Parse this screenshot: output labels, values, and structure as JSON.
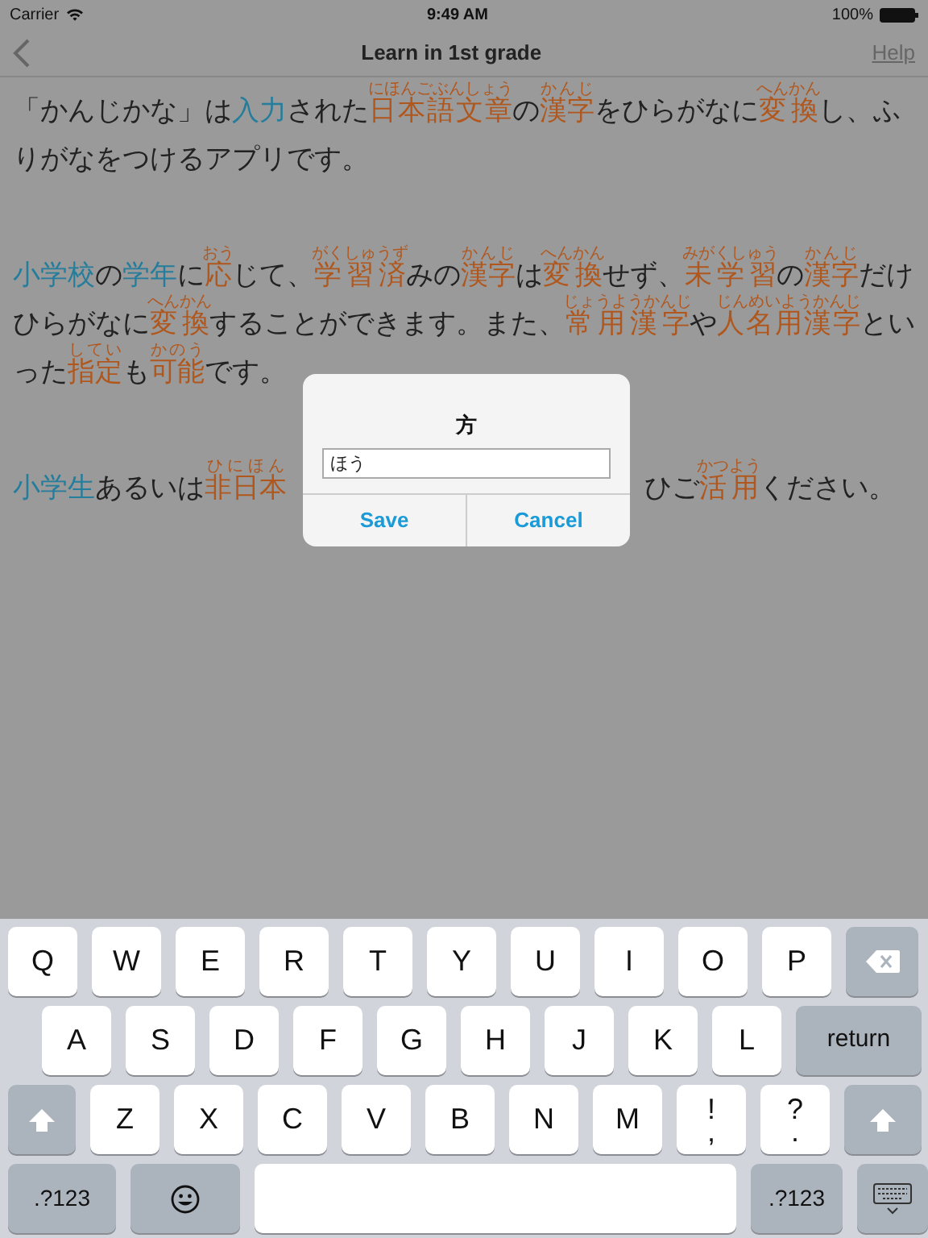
{
  "status_bar": {
    "carrier": "Carrier",
    "time": "9:49 AM",
    "battery": "100%"
  },
  "nav_bar": {
    "title": "Learn in 1st grade",
    "right_button": "Help"
  },
  "paragraphs": [
    {
      "parts": [
        {
          "segments": [
            {
              "kind": "plain",
              "text": "「かんじかな」は"
            },
            {
              "kind": "input",
              "text": "入力"
            },
            {
              "kind": "plain",
              "text": "された"
            },
            {
              "kind": "kanji",
              "text": "日本語文章",
              "ruby": "にほんごぶんしょう"
            },
            {
              "kind": "plain",
              "text": "の"
            },
            {
              "kind": "kanji",
              "text": "漢字",
              "ruby": "かんじ"
            },
            {
              "kind": "plain",
              "text": "をひらがなに"
            },
            {
              "kind": "kanji",
              "text": "変換",
              "ruby": "へんかん"
            },
            {
              "kind": "plain",
              "text": "し、ふりがなをつけるアプリです。"
            }
          ]
        }
      ]
    },
    {
      "parts": [
        {
          "segments": [
            {
              "kind": "input",
              "text": "小学校"
            },
            {
              "kind": "plain",
              "text": "の"
            },
            {
              "kind": "input",
              "text": "学年"
            },
            {
              "kind": "plain",
              "text": "に"
            },
            {
              "kind": "kanji",
              "text": "応",
              "ruby": "おう"
            },
            {
              "kind": "plain",
              "text": "じて、"
            },
            {
              "kind": "kanji",
              "text": "学習済",
              "ruby": "がくしゅうず"
            },
            {
              "kind": "plain",
              "text": "みの"
            },
            {
              "kind": "kanji",
              "text": "漢字",
              "ruby": "かんじ"
            },
            {
              "kind": "plain",
              "text": "は"
            },
            {
              "kind": "kanji",
              "text": "変換",
              "ruby": "へんかん"
            },
            {
              "kind": "plain",
              "text": "せず、"
            },
            {
              "kind": "kanji",
              "text": "未学習",
              "ruby": "みがくしゅう"
            },
            {
              "kind": "plain",
              "text": "の"
            },
            {
              "kind": "kanji",
              "text": "漢字",
              "ruby": "かんじ"
            },
            {
              "kind": "plain",
              "text": "だけひらがなに"
            },
            {
              "kind": "kanji",
              "text": "変換",
              "ruby": "へんかん"
            },
            {
              "kind": "plain",
              "text": "することができます。また、"
            },
            {
              "kind": "kanji",
              "text": "常用漢字",
              "ruby": "じょうようかんじ"
            },
            {
              "kind": "plain",
              "text": "や"
            },
            {
              "kind": "kanji",
              "text": "人名用漢字",
              "ruby": "じんめいようかんじ"
            },
            {
              "kind": "plain",
              "text": "といった"
            },
            {
              "kind": "kanji",
              "text": "指定",
              "ruby": "してい"
            },
            {
              "kind": "plain",
              "text": "も"
            },
            {
              "kind": "kanji",
              "text": "可能",
              "ruby": "かのう"
            },
            {
              "kind": "plain",
              "text": "です。"
            }
          ]
        }
      ]
    },
    {
      "parts": [
        {
          "segments": [
            {
              "kind": "input",
              "text": "小学生"
            },
            {
              "kind": "plain",
              "text": "あるいは"
            },
            {
              "kind": "kanji",
              "text": "非日本",
              "ruby": "ひにほん"
            }
          ]
        },
        {
          "segments": [
            {
              "kind": "plain",
              "text": "ひご"
            },
            {
              "kind": "kanji",
              "text": "活用",
              "ruby": "かつよう"
            },
            {
              "kind": "plain",
              "text": "ください。"
            }
          ]
        }
      ]
    }
  ],
  "dialog": {
    "title": "方",
    "value": "ほう",
    "buttons": [
      "Save",
      "Cancel"
    ]
  },
  "keyboard": {
    "rows": [
      {
        "keys": [
          {
            "kind": "letter",
            "label": "Q"
          },
          {
            "kind": "letter",
            "label": "W"
          },
          {
            "kind": "letter",
            "label": "E"
          },
          {
            "kind": "letter",
            "label": "R"
          },
          {
            "kind": "letter",
            "label": "T"
          },
          {
            "kind": "letter",
            "label": "Y"
          },
          {
            "kind": "letter",
            "label": "U"
          },
          {
            "kind": "letter",
            "label": "I"
          },
          {
            "kind": "letter",
            "label": "O"
          },
          {
            "kind": "letter",
            "label": "P"
          },
          {
            "kind": "backspace"
          }
        ]
      },
      {
        "keys": [
          {
            "kind": "letter",
            "label": "A"
          },
          {
            "kind": "letter",
            "label": "S"
          },
          {
            "kind": "letter",
            "label": "D"
          },
          {
            "kind": "letter",
            "label": "F"
          },
          {
            "kind": "letter",
            "label": "G"
          },
          {
            "kind": "letter",
            "label": "H"
          },
          {
            "kind": "letter",
            "label": "J"
          },
          {
            "kind": "letter",
            "label": "K"
          },
          {
            "kind": "letter",
            "label": "L"
          },
          {
            "kind": "return",
            "label": "return"
          }
        ]
      },
      {
        "keys": [
          {
            "kind": "shift"
          },
          {
            "kind": "letter",
            "label": "Z"
          },
          {
            "kind": "letter",
            "label": "X"
          },
          {
            "kind": "letter",
            "label": "C"
          },
          {
            "kind": "letter",
            "label": "V"
          },
          {
            "kind": "letter",
            "label": "B"
          },
          {
            "kind": "letter",
            "label": "N"
          },
          {
            "kind": "letter",
            "label": "M"
          },
          {
            "kind": "punct",
            "label": "!",
            "sub": ","
          },
          {
            "kind": "punct",
            "label": "?",
            "sub": "."
          },
          {
            "kind": "shift_right"
          }
        ]
      },
      {
        "keys": [
          {
            "kind": "numbers",
            "label": ".?123"
          },
          {
            "kind": "emoji"
          },
          {
            "kind": "space"
          },
          {
            "kind": "numbers_right",
            "label": ".?123"
          },
          {
            "kind": "hide"
          }
        ]
      }
    ]
  }
}
